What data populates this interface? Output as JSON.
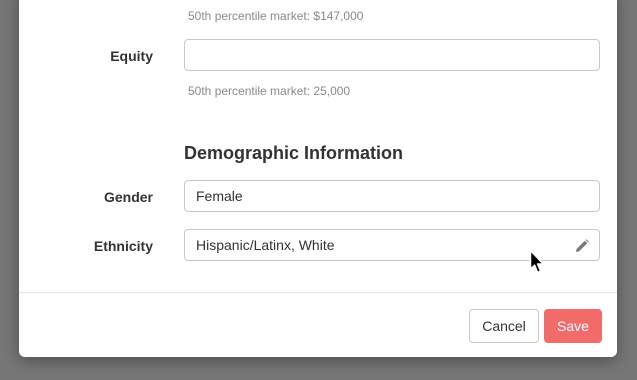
{
  "compensation": {
    "base_hint": "50th percentile market: $147,000",
    "equity_label": "Equity",
    "equity_value": "",
    "equity_hint": "50th percentile market: 25,000"
  },
  "demographics": {
    "section_title": "Demographic Information",
    "gender_label": "Gender",
    "gender_value": "Female",
    "ethnicity_label": "Ethnicity",
    "ethnicity_value": "Hispanic/Latinx, White",
    "ethnicity_edit_icon": "pencil-icon"
  },
  "footer": {
    "cancel_label": "Cancel",
    "save_label": "Save"
  },
  "colors": {
    "save_button": "#f26b6b",
    "backdrop": "#777777"
  }
}
